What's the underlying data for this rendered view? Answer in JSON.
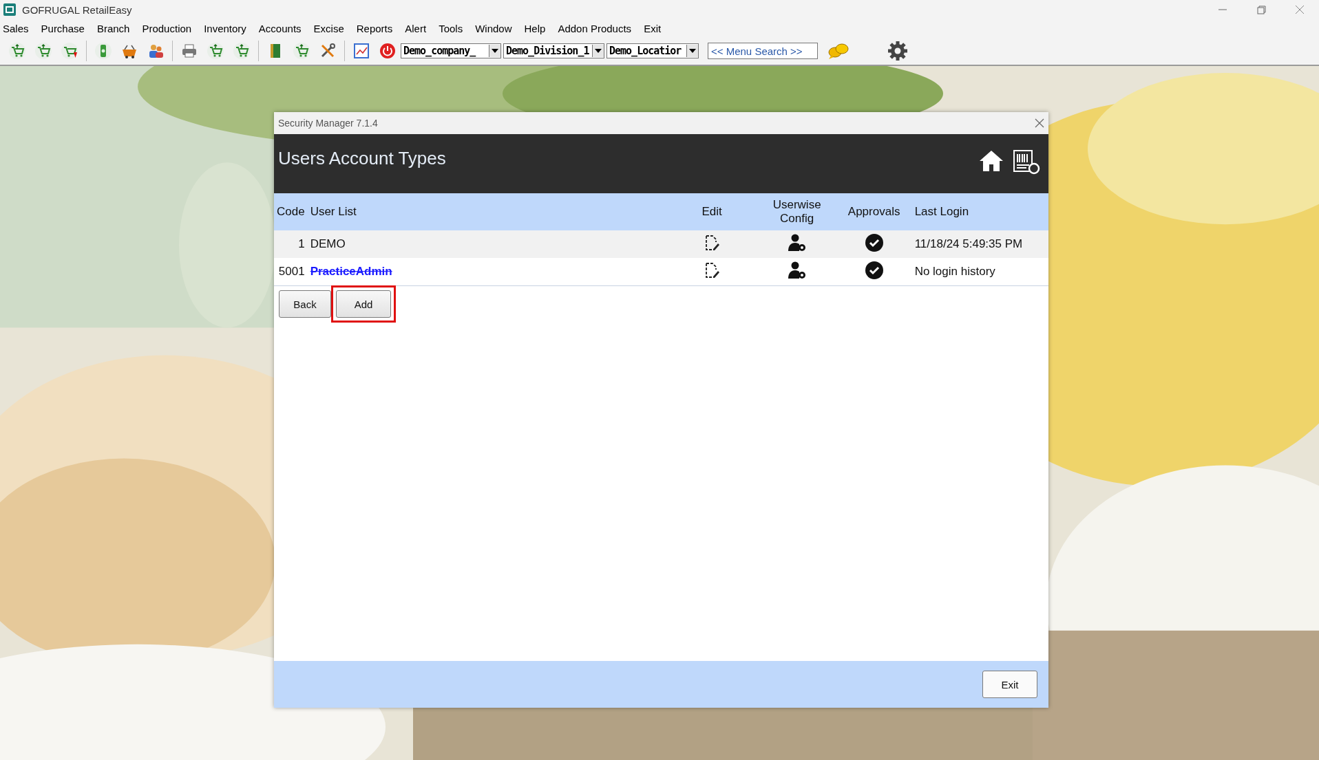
{
  "app_window": {
    "title": "GOFRUGAL RetailEasy"
  },
  "menu": [
    "Sales",
    "Purchase",
    "Branch",
    "Production",
    "Inventory",
    "Accounts",
    "Excise",
    "Reports",
    "Alert",
    "Tools",
    "Window",
    "Help",
    "Addon Products",
    "Exit"
  ],
  "toolbar": {
    "dropdowns": [
      "Demo_company_",
      "Demo_Division_1",
      "Demo_Locatior"
    ],
    "search": {
      "placeholder": "<< Menu Search >>"
    }
  },
  "dialog": {
    "title": "Security Manager 7.1.4",
    "heading": "Users Account Types",
    "columns": [
      "Code",
      "User List",
      "Edit",
      "Userwise Config",
      "Approvals",
      "Last Login"
    ],
    "rows": [
      {
        "code": "1",
        "user": "DEMO",
        "inactive": false,
        "approved": true,
        "last_login": "11/18/24 5:49:35 PM"
      },
      {
        "code": "5001",
        "user": "PracticeAdmin",
        "inactive": true,
        "approved": true,
        "last_login": "No login history"
      }
    ],
    "buttons": [
      {
        "label": "Back",
        "highlighted": false
      },
      {
        "label": "Add",
        "highlighted": true
      }
    ],
    "footer_button": "Exit"
  }
}
